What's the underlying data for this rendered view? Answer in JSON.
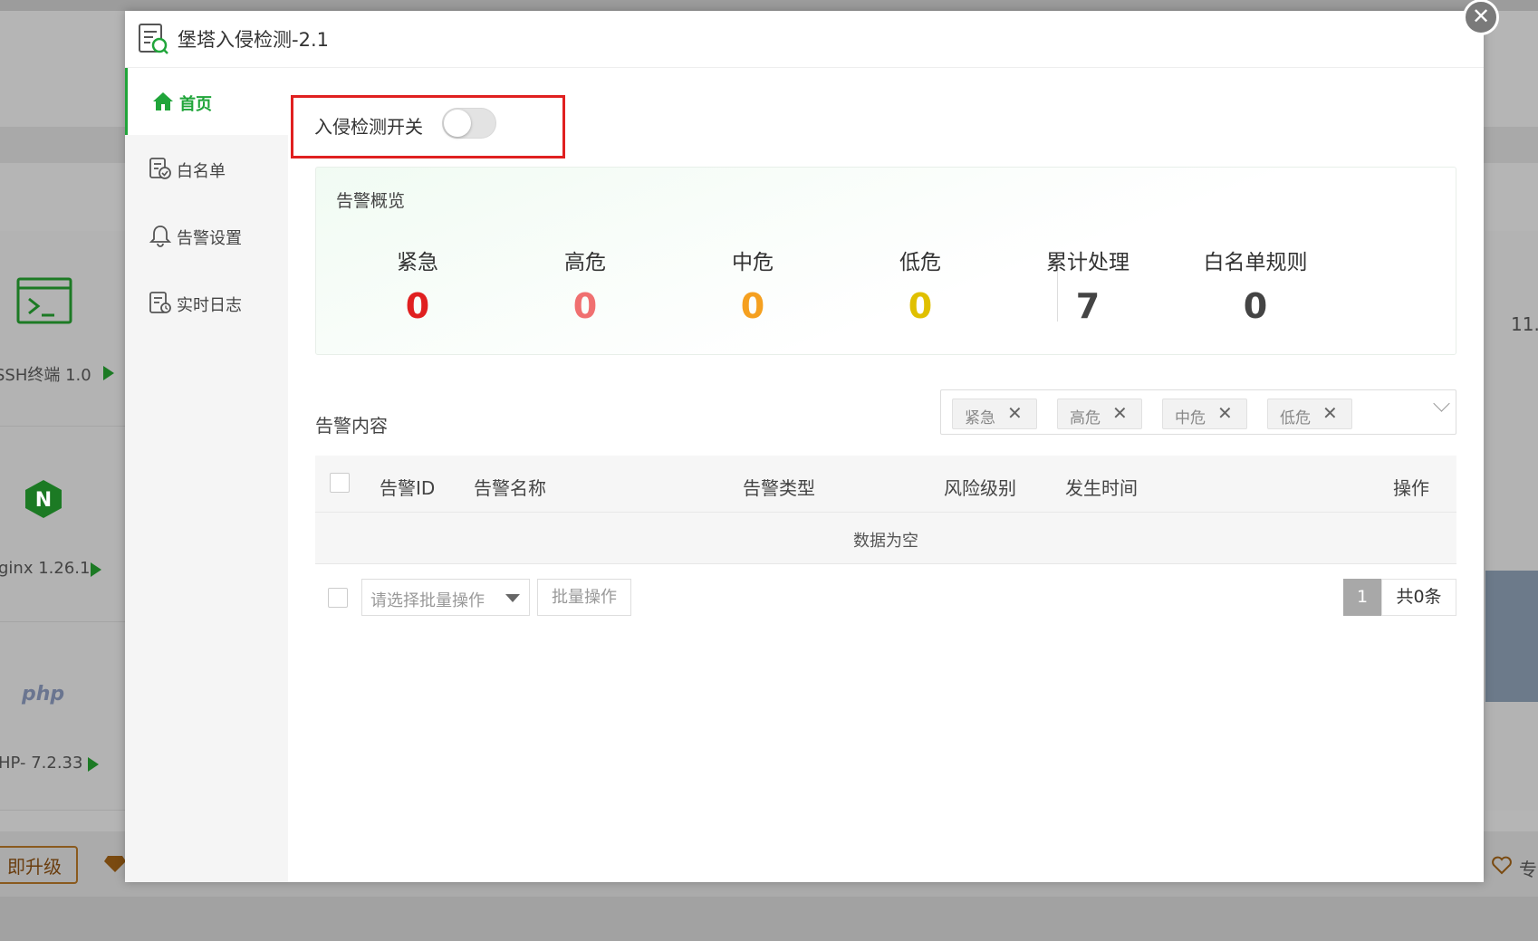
{
  "background": {
    "apps": [
      {
        "label": "SSH终端 1.0"
      },
      {
        "label": "ginx 1.26.1"
      },
      {
        "label": "HP- 7.2.33"
      }
    ],
    "upgrade_label": "即升级",
    "right_value": "11.",
    "right_text": "专"
  },
  "modal": {
    "title": "堡塔入侵检测-2.1",
    "close_glyph": "✕"
  },
  "sidebar": {
    "items": [
      {
        "label": "首页",
        "icon": "home-icon",
        "active": true
      },
      {
        "label": "白名单",
        "icon": "whitelist-icon",
        "active": false
      },
      {
        "label": "告警设置",
        "icon": "bell-icon",
        "active": false
      },
      {
        "label": "实时日志",
        "icon": "log-icon",
        "active": false
      }
    ]
  },
  "switch": {
    "label": "入侵检测开关",
    "on": false
  },
  "overview": {
    "title": "告警概览",
    "stats": [
      {
        "label": "紧急",
        "value": "0",
        "color": "#e02020"
      },
      {
        "label": "高危",
        "value": "0",
        "color": "#f07070"
      },
      {
        "label": "中危",
        "value": "0",
        "color": "#f5a020"
      },
      {
        "label": "低危",
        "value": "0",
        "color": "#e0c000"
      },
      {
        "label": "累计处理",
        "value": "7",
        "color": "#444444"
      },
      {
        "label": "白名单规则",
        "value": "0",
        "color": "#444444"
      }
    ]
  },
  "alerts": {
    "title": "告警内容",
    "filters": [
      {
        "label": "紧急"
      },
      {
        "label": "高危"
      },
      {
        "label": "中危"
      },
      {
        "label": "低危"
      }
    ],
    "remove_glyph": "✕",
    "columns": {
      "id": "告警ID",
      "name": "告警名称",
      "type": "告警类型",
      "level": "风险级别",
      "time": "发生时间",
      "action": "操作"
    },
    "empty_text": "数据为空"
  },
  "footer": {
    "batch_placeholder": "请选择批量操作",
    "batch_button": "批量操作",
    "page": "1",
    "total": "共0条"
  },
  "colors": {
    "accent": "#20a53a",
    "highlight_border": "#e02020"
  }
}
